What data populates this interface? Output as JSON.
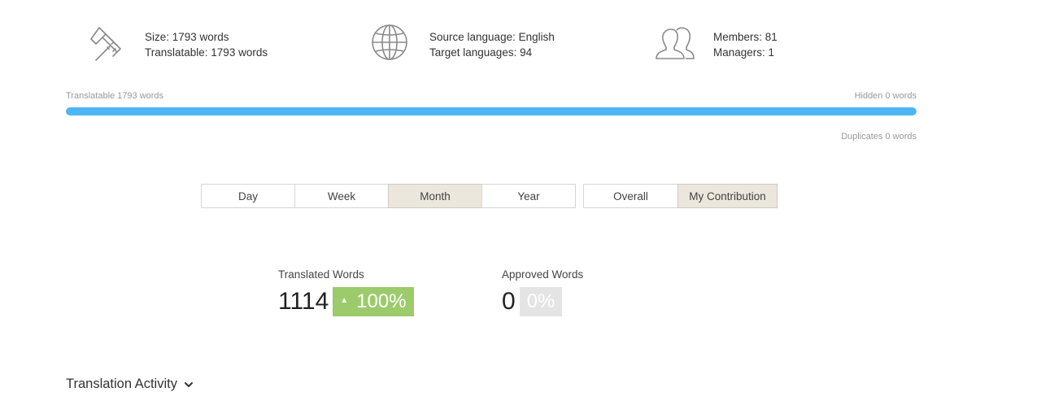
{
  "stats": {
    "size_label": "Size: 1793 words",
    "translatable_label": "Translatable: 1793 words",
    "source_label": "Source language: English",
    "target_label": "Target languages: 94",
    "members_label": "Members: 81",
    "managers_label": "Managers: 1"
  },
  "progress": {
    "left_label": "Translatable 1793 words",
    "right_label": "Hidden 0 words",
    "duplicates_label": "Duplicates 0 words",
    "translatable_fraction": 1.0
  },
  "period_filter": {
    "options": [
      "Day",
      "Week",
      "Month",
      "Year"
    ],
    "selected": "Month"
  },
  "scope_filter": {
    "options": [
      "Overall",
      "My Contribution"
    ],
    "selected": "My Contribution"
  },
  "metrics": {
    "translated": {
      "label": "Translated Words",
      "value": "1114",
      "change": "100%"
    },
    "approved": {
      "label": "Approved Words",
      "value": "0",
      "change": "0%"
    }
  },
  "section": {
    "title": "Translation Activity"
  },
  "colors": {
    "accent_blue": "#4bb5f5",
    "positive_green": "#9ccb6b",
    "neutral_gray": "#e4e4e4",
    "active_button": "#ebe7dd"
  },
  "icons": {
    "size": "caliper-icon",
    "languages": "globe-icon",
    "members": "users-icon",
    "section_toggle": "chevron-down-icon",
    "increase": "triangle-up-icon"
  }
}
